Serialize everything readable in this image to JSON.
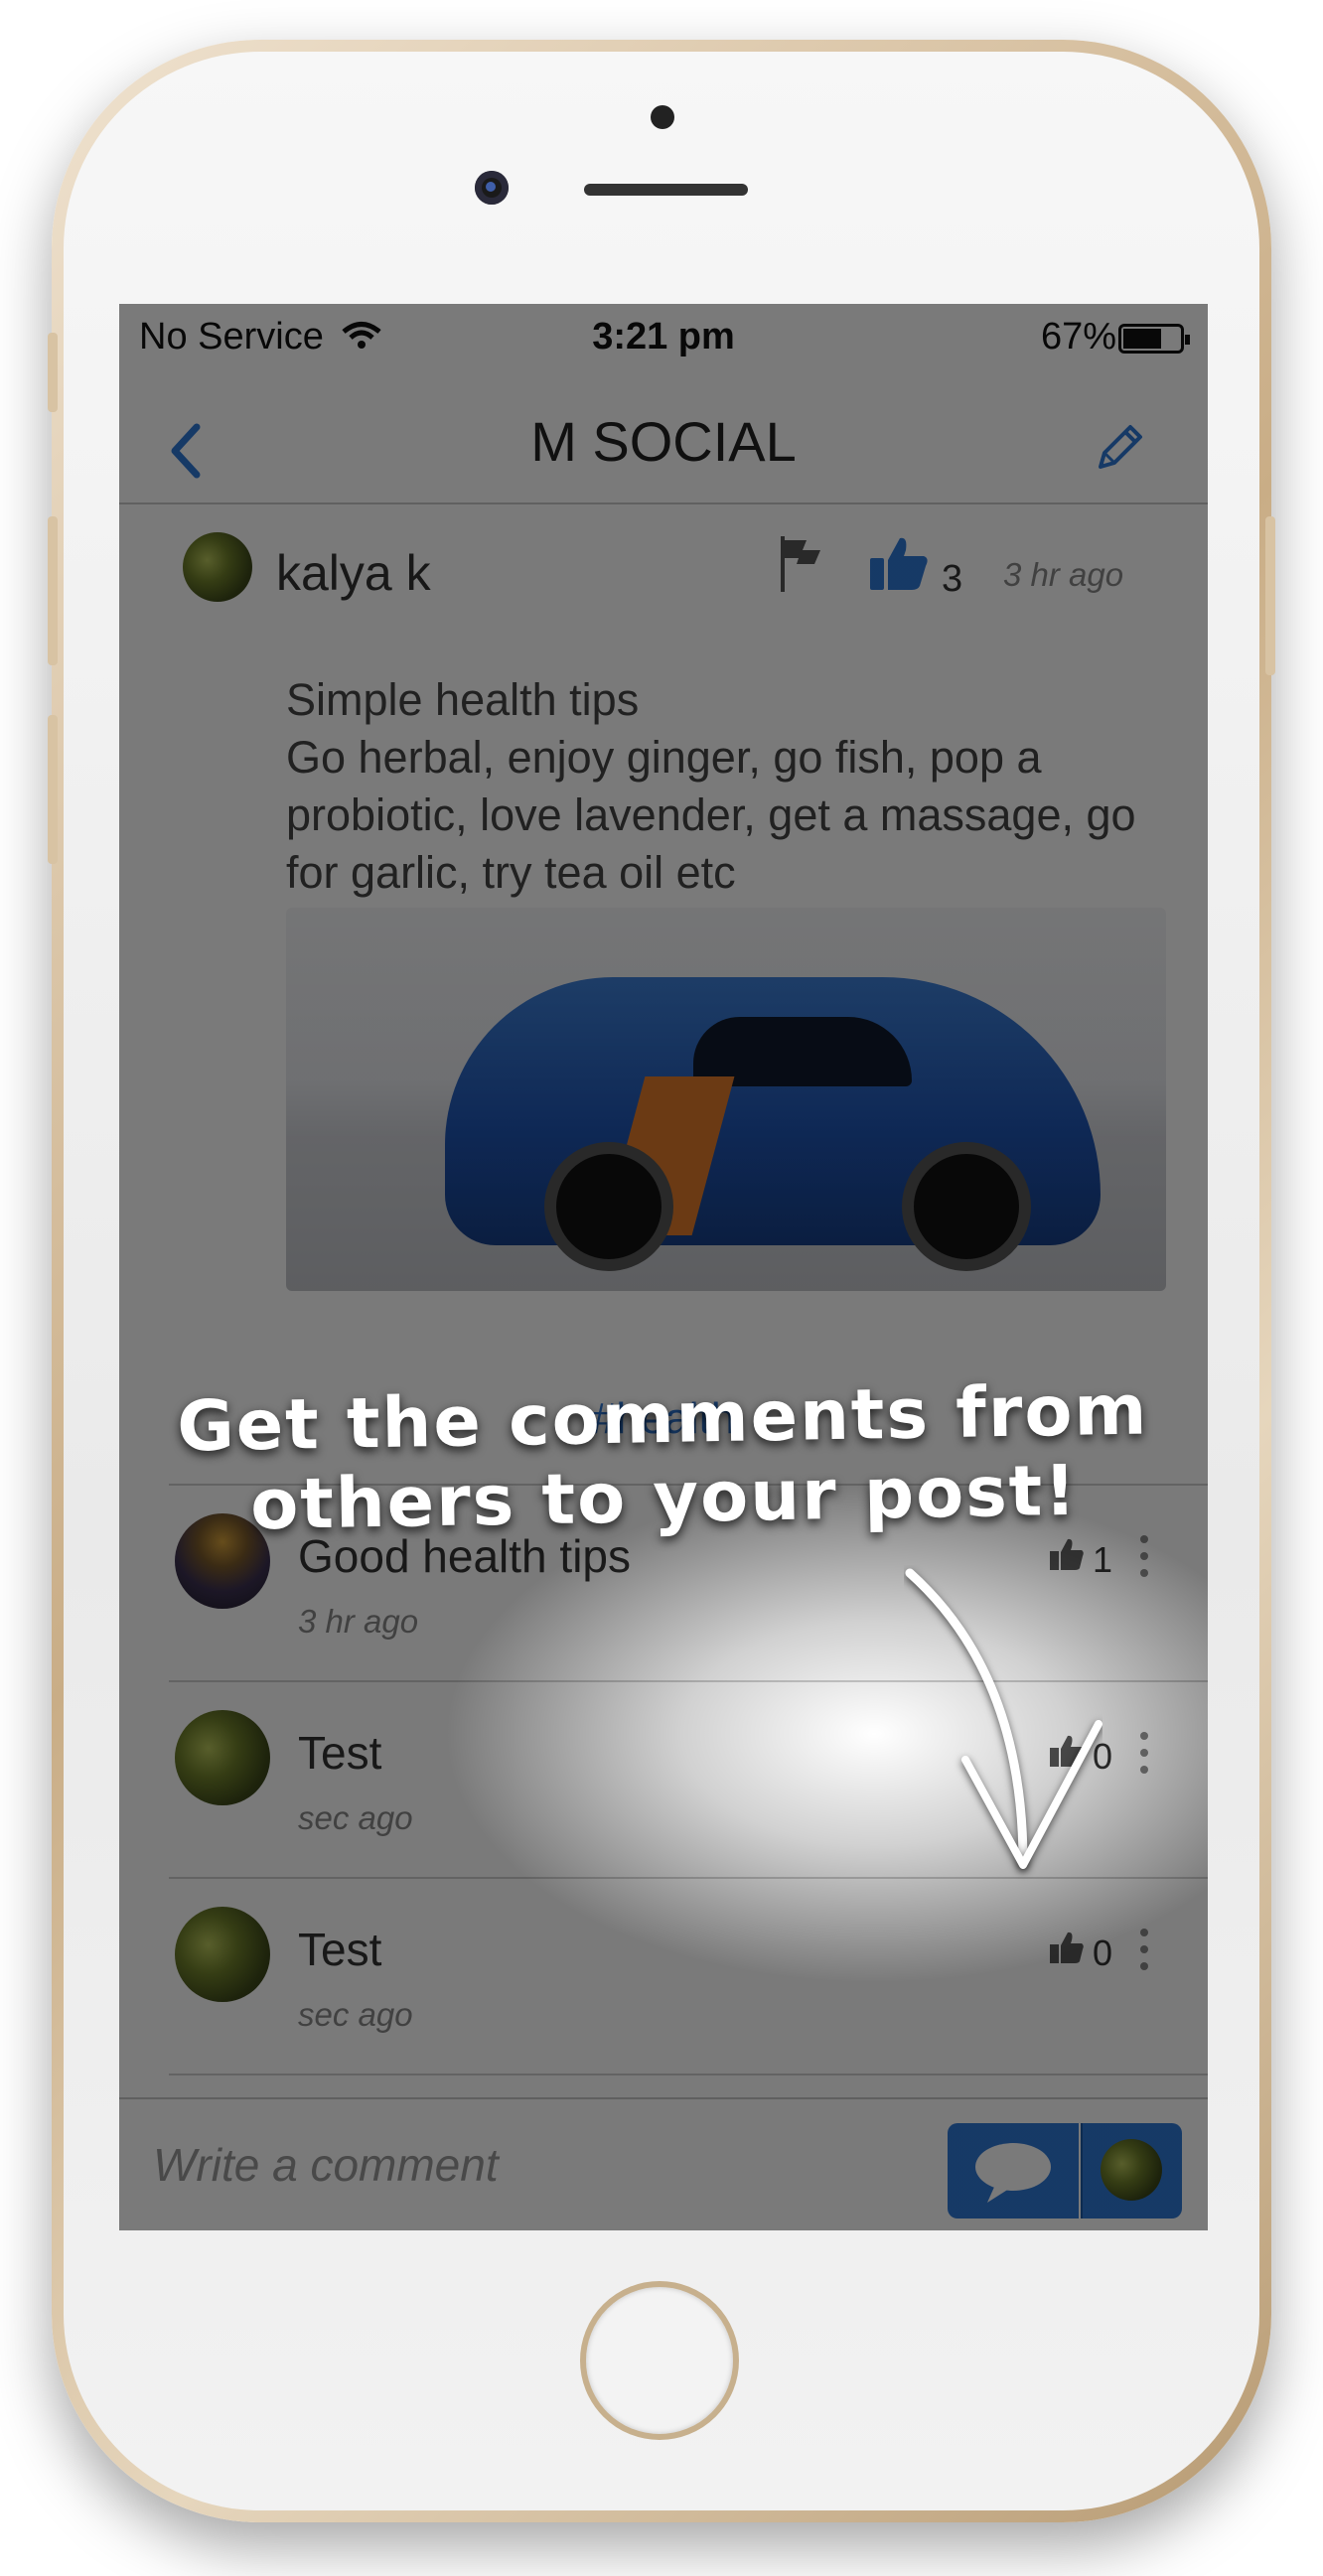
{
  "status_bar": {
    "carrier": "No Service",
    "time": "3:21 pm",
    "battery": "67%",
    "battery_level": 0.67
  },
  "nav": {
    "title": "M SOCIAL",
    "back_icon": "chevron-left-icon",
    "edit_icon": "pencil-icon"
  },
  "post": {
    "author": "kalya k",
    "likes": "3",
    "time": "3 hr ago",
    "text": "Simple health tips\nGo herbal, enjoy ginger, go fish, pop a probiotic, love lavender, get a massage, go for garlic, try tea oil etc",
    "hashtag": "#health"
  },
  "annotation": {
    "line1": "Get the comments from",
    "line2": "others to your post!"
  },
  "comments": [
    {
      "text": "Good health tips",
      "time": "3 hr ago",
      "likes": "1"
    },
    {
      "text": "Test",
      "time": "sec ago",
      "likes": "0"
    },
    {
      "text": "Test",
      "time": "sec ago",
      "likes": "0"
    }
  ],
  "composer": {
    "placeholder": "Write a comment"
  },
  "colors": {
    "accent": "#2f78d6"
  }
}
